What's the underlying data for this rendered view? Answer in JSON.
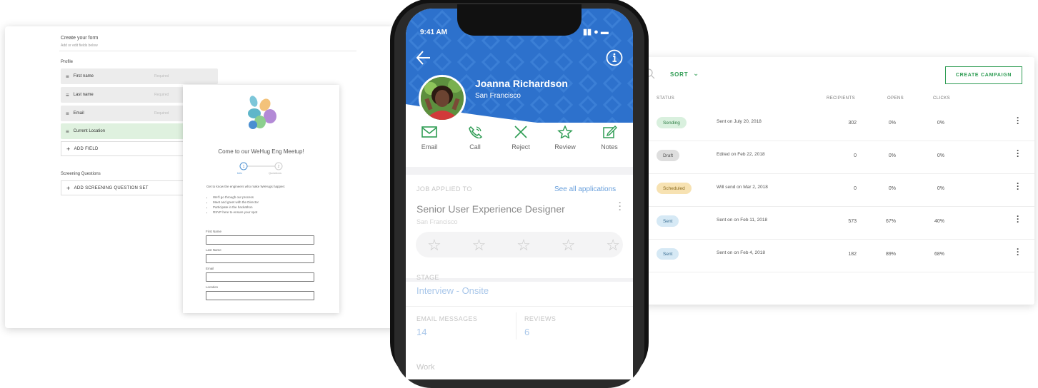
{
  "form": {
    "title": "Create your form",
    "subtitle": "Add or edit fields below",
    "profile_label": "Profile",
    "fields": [
      {
        "label": "First name",
        "status": "Required"
      },
      {
        "label": "Last name",
        "status": "Required"
      },
      {
        "label": "Email",
        "status": "Required"
      },
      {
        "label": "Current Location",
        "status": ""
      }
    ],
    "add_field": "ADD FIELD",
    "screening_label": "Screening Questions",
    "add_screening": "ADD SCREENING QUESTION SET",
    "preview": {
      "title": "Come to our WeHug Eng Meetup!",
      "step1": "Info",
      "step2": "Questions",
      "intro": "Get to know the engineers who make WeHugs happen:",
      "bullets": [
        "We'll go through our process",
        "Meet and greet with the Director",
        "Participate in the hackathon",
        "RSVP here to ensure your spot"
      ],
      "first_name": "First Name",
      "last_name": "Last Name",
      "email": "Email",
      "location": "Location"
    }
  },
  "phone": {
    "time": "9:41 AM",
    "name": "Joanna Richardson",
    "location": "San Francisco",
    "actions": [
      {
        "label": "Email",
        "icon": "mail-icon"
      },
      {
        "label": "Call",
        "icon": "phone-icon"
      },
      {
        "label": "Reject",
        "icon": "x-icon"
      },
      {
        "label": "Review",
        "icon": "star-icon"
      },
      {
        "label": "Notes",
        "icon": "edit-icon"
      }
    ],
    "job_applied_label": "JOB APPLIED TO",
    "see_all": "See all applications",
    "job_title": "Senior User Experience Designer",
    "job_location": "San Francisco",
    "rating": 0,
    "stage_label": "STAGE",
    "stage": "Interview - Onsite",
    "email_messages_label": "EMAIL MESSAGES",
    "email_messages": "14",
    "reviews_label": "REVIEWS",
    "reviews": "6",
    "work_label": "Work"
  },
  "campaigns": {
    "sort_label": "SORT",
    "create_button": "CREATE CAMPAIGN",
    "headers": {
      "status": "STATUS",
      "recipients": "RECIPIENTS",
      "opens": "OPENS",
      "clicks": "CLICKS"
    },
    "rows": [
      {
        "status": "Sending",
        "status_color": "#d9f0de",
        "status_text": "#2e7d46",
        "info": "Sent on July 20, 2018",
        "recipients": "302",
        "opens": "0%",
        "clicks": "0%"
      },
      {
        "status": "Draft",
        "status_color": "#dedede",
        "status_text": "#555555",
        "info": "Edited on Feb 22, 2018",
        "recipients": "0",
        "opens": "0%",
        "clicks": "0%"
      },
      {
        "status": "Scheduled",
        "status_color": "#f7e2b2",
        "status_text": "#8a6a1f",
        "info": "Will send on Mar 2, 2018",
        "recipients": "0",
        "opens": "0%",
        "clicks": "0%"
      },
      {
        "status": "Sent",
        "status_color": "#d6e9f5",
        "status_text": "#3c6f93",
        "info": "Sent on on Feb 11, 2018",
        "recipients": "573",
        "opens": "67%",
        "clicks": "40%"
      },
      {
        "status": "Sent",
        "status_color": "#d6e9f5",
        "status_text": "#3c6f93",
        "info": "Sent on on Feb 4, 2018",
        "recipients": "182",
        "opens": "89%",
        "clicks": "68%"
      }
    ]
  },
  "colors": {
    "accent_green": "#2e9c53",
    "phone_blue": "#2d71cc"
  }
}
